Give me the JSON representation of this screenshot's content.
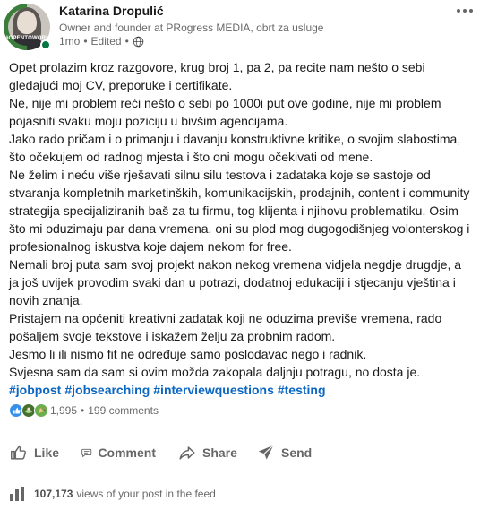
{
  "author": {
    "name": "Katarina Dropulić",
    "headline": "Owner and founder at PRogress MEDIA, obrt za usluge",
    "time": "1mo",
    "edited": "Edited",
    "bullet": "•",
    "avatar_badge": "#OPENTOWORK",
    "status_color": "#057642"
  },
  "post": {
    "lines": [
      "Opet prolazim kroz razgovore, krug broj 1, pa 2, pa recite nam nešto o sebi",
      "gledajući moj CV, preporuke i certifikate.",
      "Ne, nije mi problem reći nešto o sebi po 1000i put ove godine, nije mi problem",
      "pojasniti svaku moju poziciju u bivšim agencijama.",
      "Jako rado pričam i o primanju i davanju konstruktivne kritike, o svojim slabostima,",
      "što očekujem od radnog mjesta i što oni mogu očekivati od mene.",
      "Ne želim i neću više rješavati silnu silu testova i zadataka koje se sastoje od",
      "stvaranja kompletnih marketinških, komunikacijskih, prodajnih, content i community",
      "strategija specijaliziranih baš za tu firmu, tog klijenta i njihovu problematiku. Osim",
      "što mi oduzimaju par dana vremena, oni su plod mog dugogodišnjeg volonterskog i",
      "profesionalnog iskustva koje dajem nekom for free.",
      "Nemali broj puta sam svoj projekt nakon nekog vremena vidjela negdje drugdje, a",
      "ja još uvijek provodim svaki dan u potrazi, dodatnoj edukaciji i stjecanju vještina i",
      "novih znanja.",
      "Pristajem na općeniti kreativni zadatak koji ne oduzima previše vremena, rado",
      "pošaljem svoje tekstove i iskažem želju za probnim radom.",
      "Jesmo li ili nismo fit ne određuje samo poslodavac nego i radnik.",
      "Svjesna sam da sam si ovim možda zakopala daljnju potragu, no dosta je."
    ],
    "hashtags": [
      "#jobpost",
      "#jobsearching",
      "#interviewquestions",
      "#testing"
    ],
    "hashtag_color": "#0a66c2"
  },
  "social": {
    "reactions_count": "1,995",
    "separator": "•",
    "comments": "199 comments",
    "reaction_icons": [
      "like-icon",
      "support-icon",
      "celebrate-icon"
    ]
  },
  "actions": {
    "like": "Like",
    "comment": "Comment",
    "share": "Share",
    "send": "Send"
  },
  "analytics": {
    "views_count": "107,173",
    "views_label": "views of your post in the feed"
  }
}
